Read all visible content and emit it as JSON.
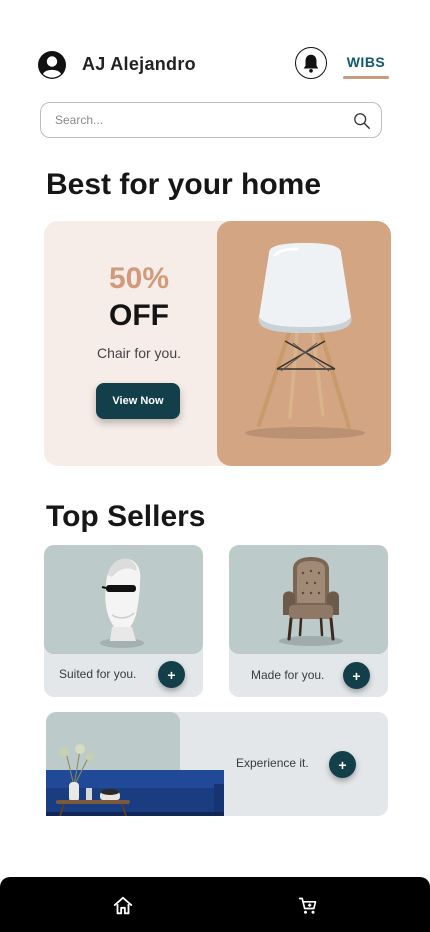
{
  "header": {
    "user_name": "AJ Alejandro",
    "brand": "WIBS",
    "avatar_icon": "user-circle-icon",
    "notification_icon": "bell-icon"
  },
  "search": {
    "placeholder": "Search...",
    "icon": "search-icon"
  },
  "home_section": {
    "title": "Best for your home"
  },
  "promo": {
    "discount": "50%",
    "off": "OFF",
    "subtitle": "Chair for you.",
    "button_label": "View Now",
    "accent_color": "#d29a7a",
    "image_bg_color": "#d4a582"
  },
  "sellers_section": {
    "title": "Top Sellers",
    "items": [
      {
        "label": "Suited for you.",
        "image": "statue-bust-image"
      },
      {
        "label": "Made for you.",
        "image": "armchair-image"
      },
      {
        "label": "Experience it.",
        "image": "blue-sofa-image"
      }
    ],
    "add_button_label": "+"
  },
  "bottom_nav": {
    "items": [
      {
        "icon": "home-icon"
      },
      {
        "icon": "cart-icon"
      }
    ]
  },
  "colors": {
    "primary_dark": "#123f49",
    "brand_text": "#0f5a6b",
    "card_bg": "#e3e7ea",
    "card_image_bg": "#bccaca",
    "promo_bg": "#f6ece8"
  }
}
